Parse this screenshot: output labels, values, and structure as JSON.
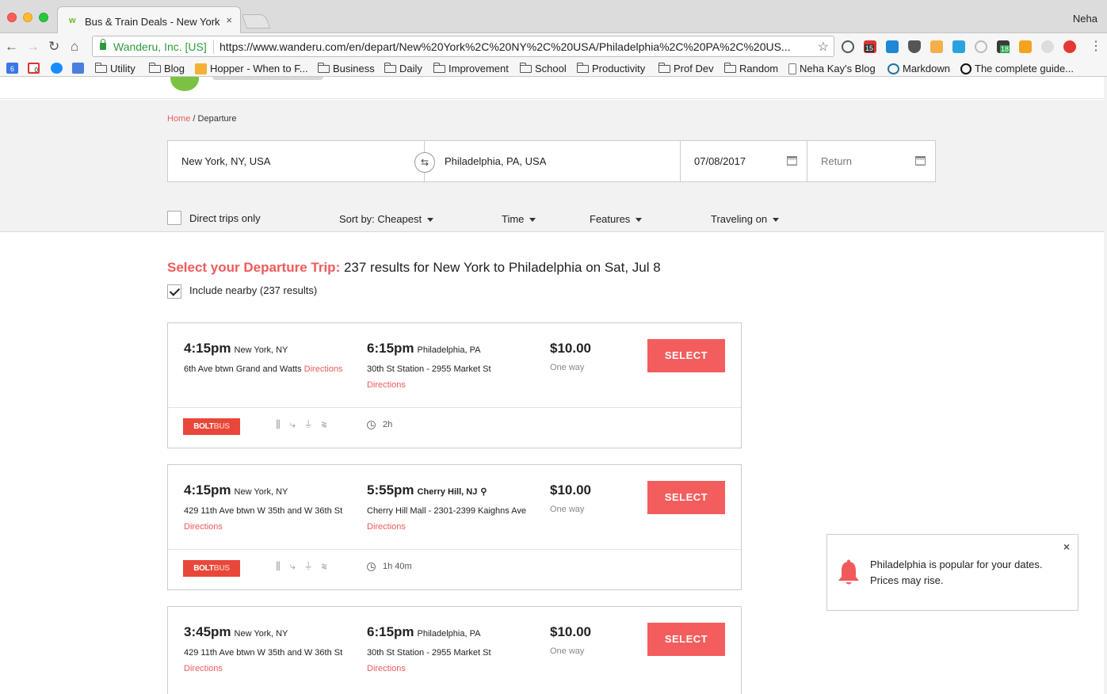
{
  "browser": {
    "tab_title": "Bus & Train Deals - New York,",
    "tab_favicon": "w",
    "tab_close": "×",
    "profile_name": "Neha",
    "site_identity": "Wanderu, Inc. [US]",
    "url": "https://www.wanderu.com/en/depart/New%20York%2C%20NY%2C%20USA/Philadelphia%2C%20PA%2C%20US...",
    "nav": {
      "back": "←",
      "forward": "→",
      "reload": "↻",
      "home": "⌂",
      "star": "☆",
      "menu": "⋮"
    },
    "extension_badges": {
      "calendar": "15",
      "inbox": "18"
    },
    "bookmarks": [
      {
        "label": "Utility",
        "type": "folder"
      },
      {
        "label": "Blog",
        "type": "folder"
      },
      {
        "label": "Hopper - When to F...",
        "type": "page"
      },
      {
        "label": "Business",
        "type": "folder"
      },
      {
        "label": "Daily",
        "type": "folder"
      },
      {
        "label": "Improvement",
        "type": "folder"
      },
      {
        "label": "School",
        "type": "folder"
      },
      {
        "label": "Productivity",
        "type": "folder"
      },
      {
        "label": "Prof Dev",
        "type": "folder"
      },
      {
        "label": "Random",
        "type": "folder"
      },
      {
        "label": "Neha Kay's Blog",
        "type": "page"
      },
      {
        "label": "Markdown",
        "type": "page"
      },
      {
        "label": "The complete guide...",
        "type": "page"
      }
    ],
    "bookmark_badges": {
      "calendar": "6",
      "gmail": "0"
    }
  },
  "breadcrumb": {
    "home": "Home",
    "sep": " / ",
    "current": "Departure"
  },
  "search": {
    "from": "New York, NY, USA",
    "to": "Philadelphia, PA, USA",
    "date": "07/08/2017",
    "return_placeholder": "Return",
    "swap_icon": "⇆"
  },
  "filters": {
    "direct_only": "Direct trips only",
    "sort": "Sort by: Cheapest",
    "time": "Time",
    "features": "Features",
    "traveling_on": "Traveling on"
  },
  "results": {
    "heading_accent": "Select your Departure Trip:",
    "heading_text": " 237 results for New York to Philadelphia on Sat, Jul 8",
    "include_nearby": "Include nearby (237 results)"
  },
  "trips": [
    {
      "depart_time": "4:15pm",
      "depart_city": "New York, NY",
      "depart_addr": "6th Ave btwn Grand and Watts",
      "arrive_time": "6:15pm",
      "arrive_city": "Philadelphia, PA",
      "arrive_addr": "30th St Station - 2955 Market St",
      "price": "$10.00",
      "fare_type": "One way",
      "select": "SELECT",
      "carrier_a": "BOLT",
      "carrier_b": "BUS",
      "duration": "2h"
    },
    {
      "depart_time": "4:15pm",
      "depart_city": "New York, NY",
      "depart_addr": "429 11th Ave btwn W 35th and W 36th St",
      "arrive_time": "5:55pm",
      "arrive_city": "Cherry Hill, NJ",
      "arrive_addr": "Cherry Hill Mall - 2301-2399 Kaighns Ave",
      "price": "$10.00",
      "fare_type": "One way",
      "select": "SELECT",
      "carrier_a": "BOLT",
      "carrier_b": "BUS",
      "duration": "1h 40m"
    },
    {
      "depart_time": "3:45pm",
      "depart_city": "New York, NY",
      "depart_addr": "429 11th Ave btwn W 35th and W 36th St",
      "arrive_time": "6:15pm",
      "arrive_city": "Philadelphia, PA",
      "arrive_addr": "30th St Station - 2955 Market St",
      "price": "$10.00",
      "fare_type": "One way",
      "select": "SELECT"
    }
  ],
  "directions_label": "Directions",
  "amenities_glyphs": "⫼ ⤷ ⏚ ≋",
  "toast": {
    "message": "Philadelphia is popular for your dates. Prices may rise.",
    "close": "×",
    "accent_color": "#f05a5b"
  },
  "colors": {
    "accent": "#f05a5b",
    "select_button": "#f45d5d",
    "bolt_bus": "#e8473a",
    "secure_green": "#2f9a3c"
  }
}
